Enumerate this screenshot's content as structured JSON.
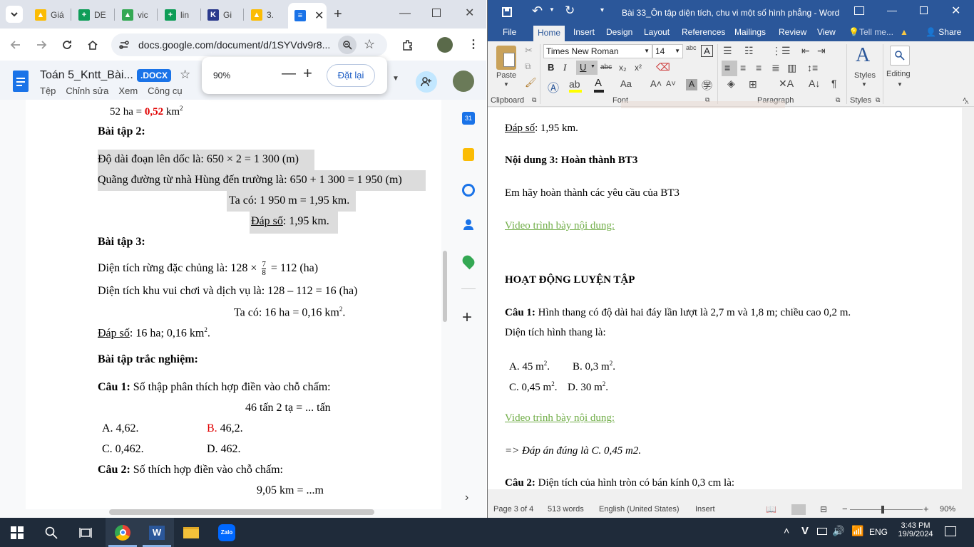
{
  "chrome": {
    "tabs": [
      {
        "label": "Giá",
        "color": "#f4b400",
        "glyph": "▲"
      },
      {
        "label": "DE",
        "color": "#0f9d58",
        "glyph": "+"
      },
      {
        "label": "vic",
        "color": "#34a853",
        "glyph": "▲"
      },
      {
        "label": "lin",
        "color": "#0f9d58",
        "glyph": "+"
      },
      {
        "label": "Gi",
        "color": "#2b3a8c",
        "glyph": "K"
      },
      {
        "label": "3.",
        "color": "#fbbc04",
        "glyph": "▲"
      }
    ],
    "url": "docs.google.com/document/d/1SYVdv9r8...",
    "doc_title": "Toán 5_Kntt_Bài...",
    "doc_badge": ".DOCX",
    "menus": [
      "Tệp",
      "Chỉnh sửa",
      "Xem",
      "Công cụ"
    ],
    "zoom": {
      "value": "90%",
      "reset_label": "Đặt lại"
    }
  },
  "gdoc": {
    "l0_pre": "52 ha = ",
    "l0_val": "0,52",
    "l0_unit": " km",
    "l0_sup": "2",
    "bt2": "Bài tập 2:",
    "bt2_l1": "Độ dài đoạn lên dốc là:  650 × 2 = 1 300 (m)",
    "bt2_l2": "Quãng đường từ nhà Hùng đến trường là:  650 + 1 300 = 1 950 (m)",
    "bt2_l3": "Ta có: 1 950 m = 1,95 km.",
    "bt2_ans_label": "Đáp số",
    "bt2_ans": ": 1,95 km.",
    "bt3": "Bài tập 3:",
    "bt3_l1_pre": "Diện tích rừng đặc chủng là: 128 ×",
    "bt3_l1_num": "7",
    "bt3_l1_den": "8",
    "bt3_l1_post": "= 112 (ha)",
    "bt3_l2": "Diện tích khu vui chơi và dịch vụ là:  128 – 112 = 16 (ha)",
    "bt3_l3": "Ta có: 16 ha = 0,16 km",
    "bt3_l3_sup": "2",
    "bt3_l3_end": ".",
    "bt3_ans_label": "Đáp số",
    "bt3_ans": ": 16 ha; 0,16 km",
    "bt3_ans_sup": "2",
    "bt3_ans_end": ".",
    "tn": "Bài tập trắc nghiệm:",
    "c1_label": "Câu 1:",
    "c1_text": " Số thập phân thích hợp điền vào chỗ chấm:",
    "c1_expr": "46 tấn 2 tạ  = ... tấn",
    "c1_a": "A. 4,62.",
    "c1_b_letter": "B.",
    "c1_b": " 46,2.",
    "c1_c": "C. 0,462.",
    "c1_d": "D. 462.",
    "c2_label": "Câu 2:",
    "c2_text": " Số thích hợp điền vào chỗ chấm:",
    "c2_expr": "9,05 km = ...m"
  },
  "word": {
    "title": "Bài 33_Ôn tập diện tích, chu vi một số hình phẳng  -  Word",
    "tabs": [
      "File",
      "Home",
      "Insert",
      "Design",
      "Layout",
      "References",
      "Mailings",
      "Review",
      "View"
    ],
    "tell_me": "Tell me...",
    "share": "Share",
    "font_name": "Times New Roman",
    "font_size": "14",
    "groups": [
      "Clipboard",
      "Font",
      "Paragraph",
      "Styles"
    ],
    "paste": "Paste",
    "styles": "Styles",
    "editing": "Editing",
    "doc": {
      "ans_label": "Đáp số",
      "ans": ": 1,95 km.",
      "nd3": "Nội dung 3: Hoàn thành BT3",
      "nd3_text": "Em hãy hoàn thành các yêu cầu của BT3",
      "video1": "Video trình bày nội dung:",
      "hd": "HOẠT ĐỘNG LUYỆN TẬP",
      "q1_label": "Câu 1:",
      "q1_text": "  Hình thang có độ dài hai đáy lần lượt là 2,7 m và 1,8 m; chiều cao 0,2 m.",
      "q1_text2": "Diện tích hình thang là:",
      "q1_a": "A. 45 m",
      "q1_b": "B. 0,3 m",
      "q1_c": "C. 0,45 m",
      "q1_d": "D. 30 m",
      "sup2": "2",
      "dot": ".",
      "video2": " Video trình bày nội dung:",
      "answer": "=> Đáp án đúng là C. 0,45 m2.",
      "q2_label": "Câu 2:",
      "q2_text": " Diện tích của hình tròn có bán kính 0,3 cm là:"
    },
    "status": {
      "page": "Page 3 of 4",
      "words": "513 words",
      "lang": "English (United States)",
      "mode": "Insert",
      "zoom": "90%"
    }
  },
  "taskbar": {
    "lang": "ENG",
    "time": "3:43 PM",
    "date": "19/9/2024",
    "zalo": "Zalo"
  },
  "colors": {
    "word_blue": "#2b579a",
    "docs_blue": "#1a73e8",
    "taskbar": "#1f2b3a"
  }
}
